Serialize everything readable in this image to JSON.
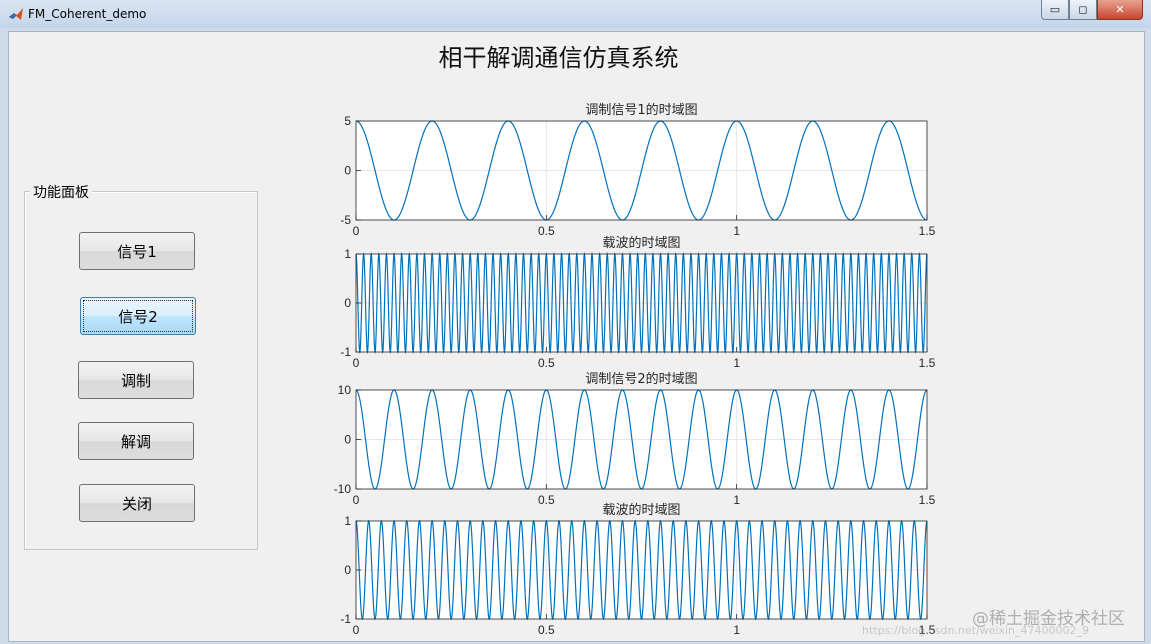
{
  "window": {
    "title": "FM_Coherent_demo",
    "min_glyph": "▭",
    "max_glyph": "◻",
    "close_glyph": "✕"
  },
  "page": {
    "heading": "相干解调通信仿真系统"
  },
  "panel": {
    "title": "功能面板",
    "buttons": [
      {
        "label": "信号1",
        "active": false
      },
      {
        "label": "信号2",
        "active": true
      },
      {
        "label": "调制",
        "active": false
      },
      {
        "label": "解调",
        "active": false
      },
      {
        "label": "关闭",
        "active": false
      }
    ]
  },
  "chart_data": [
    {
      "type": "line",
      "title": "调制信号1的时域图",
      "xlim": [
        0,
        1.5
      ],
      "ylim": [
        -5,
        5
      ],
      "xticks": [
        "0",
        "0.5",
        "1",
        "1.5"
      ],
      "yticks": [
        "-5",
        "0",
        "5"
      ],
      "grid": true,
      "series": [
        {
          "function": "cosine",
          "amplitude": 5,
          "frequency": 5
        }
      ],
      "color": "#0072bd"
    },
    {
      "type": "line",
      "title": "载波的时域图",
      "xlim": [
        0,
        1.5
      ],
      "ylim": [
        -1,
        1
      ],
      "xticks": [
        "0",
        "0.5",
        "1",
        "1.5"
      ],
      "yticks": [
        "-1",
        "0",
        "1"
      ],
      "grid": true,
      "series": [
        {
          "function": "cosine",
          "amplitude": 1,
          "frequency": 50
        }
      ],
      "color": "#0072bd"
    },
    {
      "type": "line",
      "title": "调制信号2的时域图",
      "xlim": [
        0,
        1.5
      ],
      "ylim": [
        -10,
        10
      ],
      "xticks": [
        "0",
        "0.5",
        "1",
        "1.5"
      ],
      "yticks": [
        "-10",
        "0",
        "10"
      ],
      "grid": true,
      "series": [
        {
          "function": "cosine",
          "amplitude": 10,
          "frequency": 10
        }
      ],
      "color": "#0072bd"
    },
    {
      "type": "line",
      "title": "载波的时域图",
      "xlim": [
        0,
        1.5
      ],
      "ylim": [
        -1,
        1
      ],
      "xticks": [
        "0",
        "0.5",
        "1",
        "1.5"
      ],
      "yticks": [
        "-1",
        "0",
        "1"
      ],
      "grid": true,
      "series": [
        {
          "function": "cosine",
          "amplitude": 1,
          "frequency": 30
        }
      ],
      "color": "#0072bd"
    }
  ],
  "watermarks": {
    "juejin": "@稀土掘金技术社区",
    "csdn": "https://blog.csdn.net/weixin_47400002_9"
  }
}
